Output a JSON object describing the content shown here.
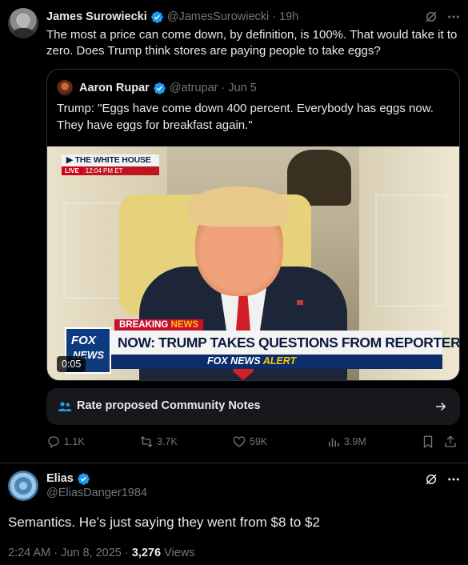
{
  "tweet": {
    "author_name": "James Surowiecki",
    "author_handle": "@JamesSurowiecki",
    "time": "19h",
    "text": "The most a price can come down, by definition, is 100%. That would take it to zero. Does Trump think stores are paying people to take eggs?",
    "quoted": {
      "author_name": "Aaron Rupar",
      "author_handle": "@atrupar",
      "date": "Jun 5",
      "text": "Trump: \"Eggs have come down 400 percent. Everybody has eggs now. They have eggs for breakfast again.\"",
      "video": {
        "bug_title": "THE WHITE HOUSE",
        "bug_live": "LIVE",
        "bug_time": "12:04 PM ET",
        "logo_line1": "FOX",
        "logo_line2": "NEWS",
        "breaking_1": "BREAKING",
        "breaking_2": "NEWS",
        "headline": "NOW: TRUMP TAKES QUESTIONS FROM REPORTERS",
        "alert_1": "FOX NEWS",
        "alert_2": "ALERT",
        "duration": "0:05"
      }
    },
    "community_notes_label": "Rate proposed Community Notes",
    "stats": {
      "replies": "1.1K",
      "reposts": "3.7K",
      "likes": "59K",
      "views": "3.9M"
    }
  },
  "reply": {
    "author_name": "Elias",
    "author_handle": "@EliasDanger1984",
    "text": "Semantics. He’s just saying they went from $8 to $2",
    "timestamp": "2:24 AM · Jun 8, 2025 · ",
    "views_count": "3,276",
    "views_label": " Views"
  },
  "colors": {
    "background": "#000000",
    "text": "#e7e9ea",
    "muted": "#71767b",
    "verified": "#1d9bf0",
    "border": "#2f3336"
  },
  "icons": [
    "verified-badge-icon",
    "grok-icon",
    "more-icon",
    "people-icon",
    "arrow-right-icon",
    "reply-icon",
    "repost-icon",
    "like-icon",
    "views-icon",
    "bookmark-icon",
    "share-icon"
  ]
}
